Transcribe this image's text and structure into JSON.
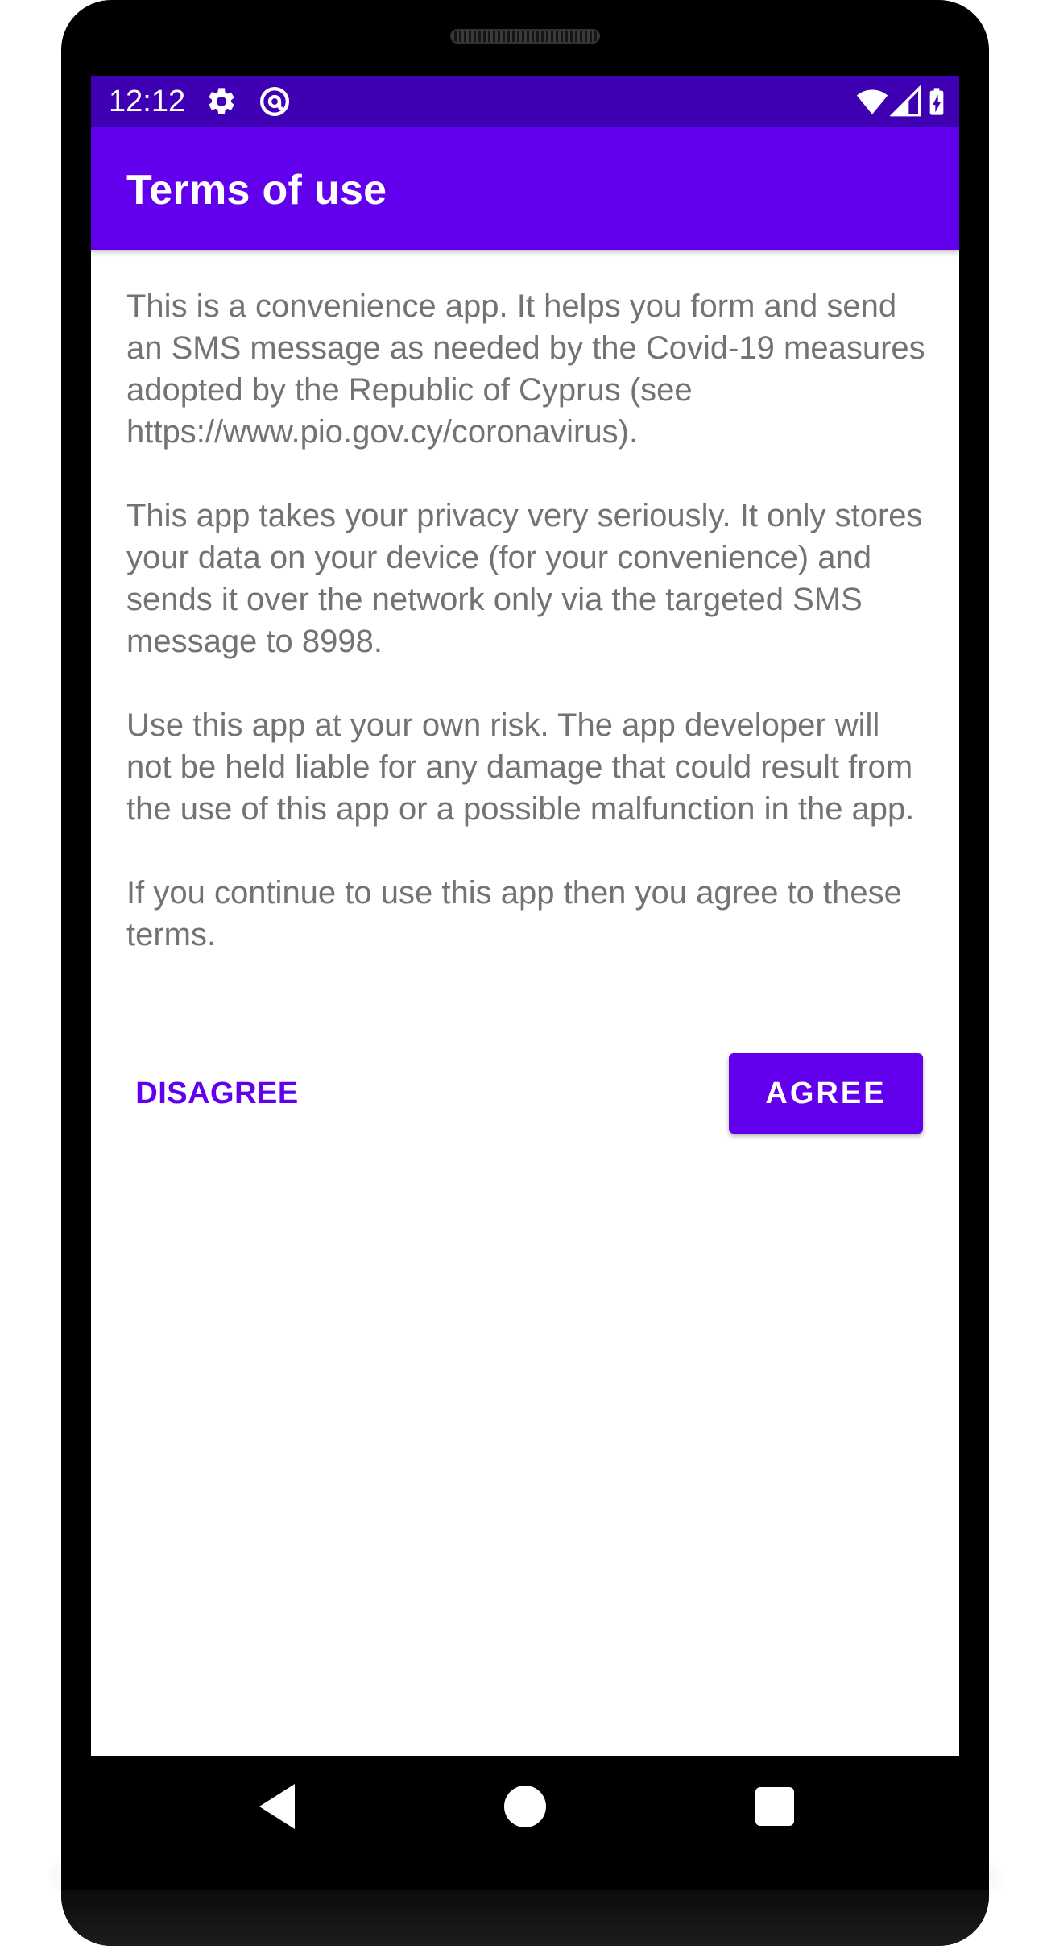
{
  "status_bar": {
    "time": "12:12",
    "icons": [
      "gear-icon",
      "at-sign-icon",
      "wifi-icon",
      "cell-signal-icon",
      "battery-charging-icon"
    ],
    "color": "#3f00b4"
  },
  "app_bar": {
    "title": "Terms of use",
    "color": "#6200ee"
  },
  "terms": {
    "paragraphs": [
      "This is a convenience app. It helps you form and send an SMS message as needed by the Covid-19 measures adopted by the Republic of Cyprus (see https://www.pio.gov.cy/coronavirus).",
      "This app takes your privacy very seriously. It only stores your data on your device (for your convenience) and sends it over the network only via the targeted SMS message to 8998.",
      "Use this app at your own risk. The app developer will not be held liable for any damage that could result from the use of this app or a possible malfunction in the app.",
      "If you continue to use this app then you agree to these terms."
    ],
    "text_color": "#737373"
  },
  "actions": {
    "disagree_label": "DISAGREE",
    "agree_label": "AGREE",
    "accent_color": "#6200ee"
  },
  "nav_bar": {
    "icons": [
      "back-icon",
      "home-icon",
      "recents-icon"
    ]
  }
}
